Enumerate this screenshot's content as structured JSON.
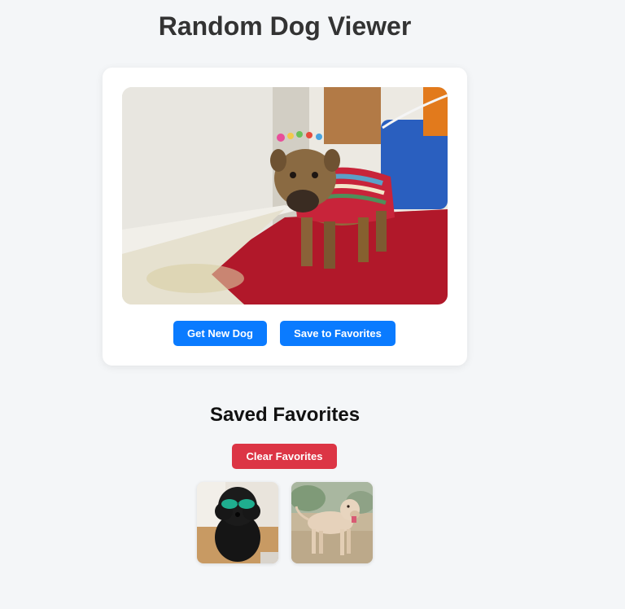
{
  "header": {
    "title": "Random Dog Viewer"
  },
  "viewer": {
    "image_icon": "dog-photo",
    "new_dog_label": "Get New Dog",
    "save_label": "Save to Favorites"
  },
  "favorites": {
    "title": "Saved Favorites",
    "clear_label": "Clear Favorites",
    "items": [
      {
        "icon": "black-poodle-photo"
      },
      {
        "icon": "tan-dog-photo"
      }
    ]
  },
  "colors": {
    "background": "#f4f6f8",
    "primary_button": "#0a7bff",
    "danger_button": "#dc3545",
    "card": "#ffffff"
  }
}
